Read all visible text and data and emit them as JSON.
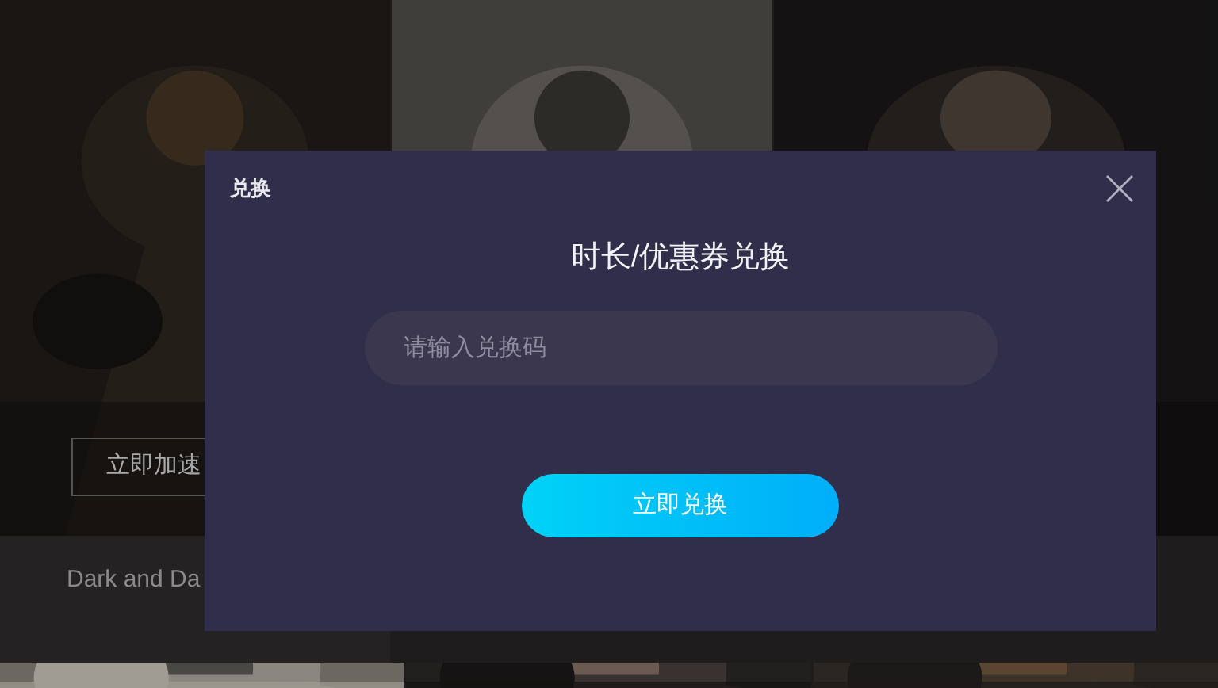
{
  "games": [
    {
      "kind": "picture",
      "button": "立即加速",
      "title": "Dark and Da"
    },
    {
      "kind": "picture"
    },
    {
      "kind": "picture"
    }
  ],
  "dialog": {
    "title": "兑换",
    "heading": "时长/优惠券兑换",
    "input": {
      "placeholder": "请输入兑换码"
    },
    "submit": "立即兑换"
  }
}
